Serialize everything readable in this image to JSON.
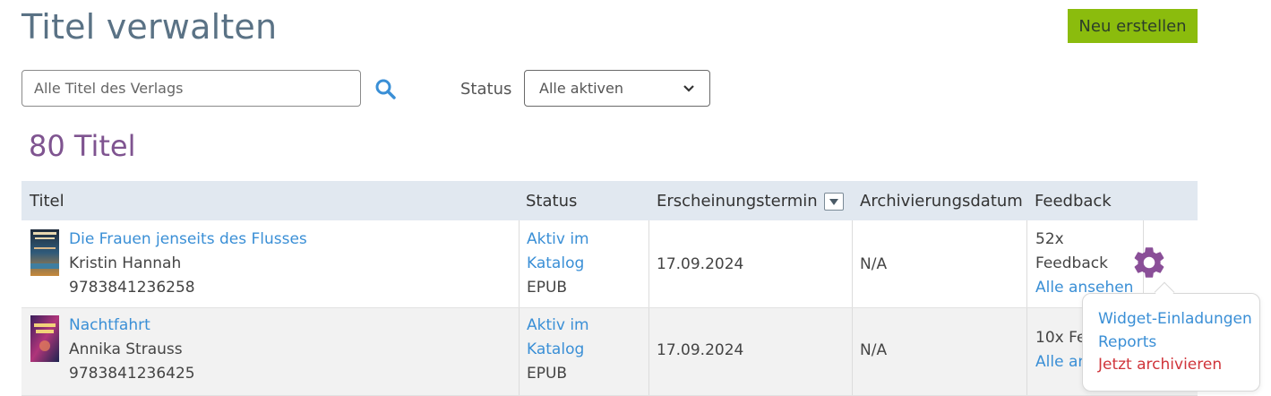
{
  "header": {
    "title": "Titel verwalten",
    "new_button": "Neu erstellen"
  },
  "filters": {
    "search_placeholder": "Alle Titel des Verlags",
    "status_label": "Status",
    "status_selected": "Alle aktiven"
  },
  "count": "80 Titel",
  "table": {
    "columns": [
      "Titel",
      "Status",
      "Erscheinungstermin",
      "Archivierungsdatum",
      "Feedback"
    ],
    "rows": [
      {
        "title": "Die Frauen jenseits des Flusses",
        "author": "Kristin Hannah",
        "isbn": "9783841236258",
        "status_line1": "Aktiv im",
        "status_line2": "Katalog",
        "format": "EPUB",
        "release_date": "17.09.2024",
        "archive_date": "N/A",
        "feedback_count": "52x",
        "feedback_label": "Feedback",
        "feedback_link": "Alle ansehen"
      },
      {
        "title": "Nachtfahrt",
        "author": "Annika Strauss",
        "isbn": "9783841236425",
        "status_line1": "Aktiv im",
        "status_line2": "Katalog",
        "format": "EPUB",
        "release_date": "17.09.2024",
        "archive_date": "N/A",
        "feedback_partial": "10x Fe",
        "feedback_link_partial": "Alle an"
      }
    ]
  },
  "action_menu": {
    "items": [
      "Widget-Einladungen",
      "Reports",
      "Jetzt archivieren"
    ]
  },
  "colors": {
    "title": "#5a7285",
    "accent_button": "#8bbc0d",
    "count": "#7f5490",
    "link": "#3a8fd6",
    "danger": "#d0343a",
    "gear": "#8a4f98",
    "table_header": "#e1e8f0"
  },
  "icons": {
    "search": "search-icon",
    "gear": "gear-icon",
    "sort": "sort-desc-icon",
    "select": "chevron-down-icon"
  }
}
